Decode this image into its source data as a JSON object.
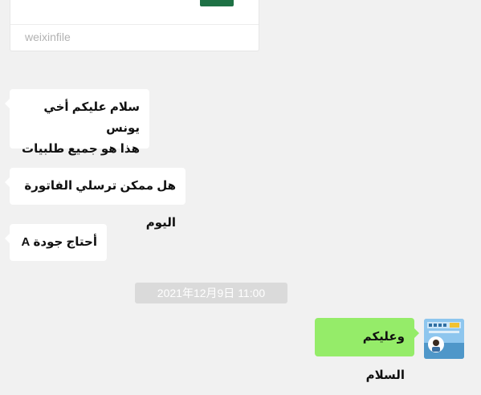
{
  "file_card": {
    "source_label": "weixinfile",
    "icon": "excel-file-icon",
    "icon_color": "#1e7145"
  },
  "messages": [
    {
      "side": "left",
      "lines": [
        "سلام عليكم أخي يونس",
        "هذا هو جميع طلبيات"
      ]
    },
    {
      "side": "left",
      "lines": [
        "هل ممكن ترسلي الفاتورة اليوم"
      ]
    },
    {
      "side": "left",
      "lines": [
        "أحتاج جودة A"
      ]
    }
  ],
  "timestamp": "2021年12月9日 11:00",
  "outgoing": {
    "side": "right",
    "text": "وعليكم السلام",
    "avatar": "user-avatar"
  },
  "colors": {
    "background": "#f1f1f1",
    "incoming_bubble": "#ffffff",
    "outgoing_bubble": "#95ec69",
    "timestamp_bg": "#dadada"
  }
}
